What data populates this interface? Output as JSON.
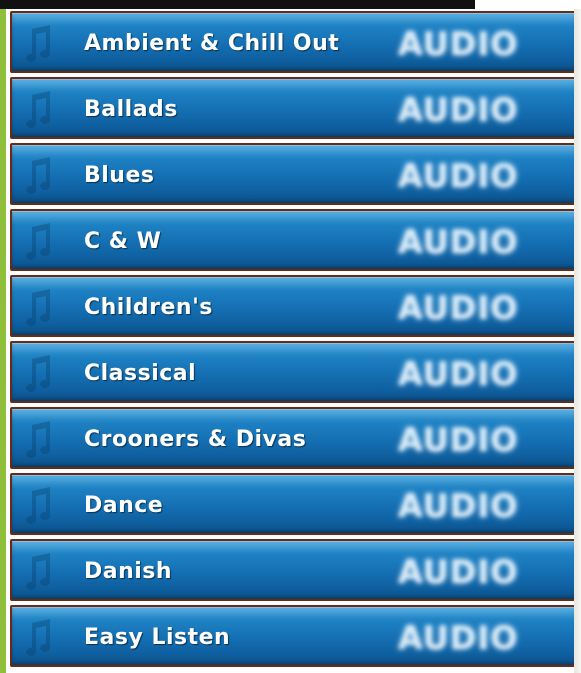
{
  "genres": [
    {
      "label": "Ambient & Chill Out",
      "badge": "AUDIO"
    },
    {
      "label": "Ballads",
      "badge": "AUDIO"
    },
    {
      "label": "Blues",
      "badge": "AUDIO"
    },
    {
      "label": "C & W",
      "badge": "AUDIO"
    },
    {
      "label": "Children's",
      "badge": "AUDIO"
    },
    {
      "label": "Classical",
      "badge": "AUDIO"
    },
    {
      "label": "Crooners & Divas",
      "badge": "AUDIO"
    },
    {
      "label": "Dance",
      "badge": "AUDIO"
    },
    {
      "label": "Danish",
      "badge": "AUDIO"
    },
    {
      "label": "Easy Listen",
      "badge": "AUDIO"
    }
  ],
  "icons": {
    "row_icon": "music-note-icon"
  },
  "colors": {
    "row_blue": "#146fb2",
    "row_border": "#6a2a14",
    "frame_green": "#8fbf3a"
  }
}
